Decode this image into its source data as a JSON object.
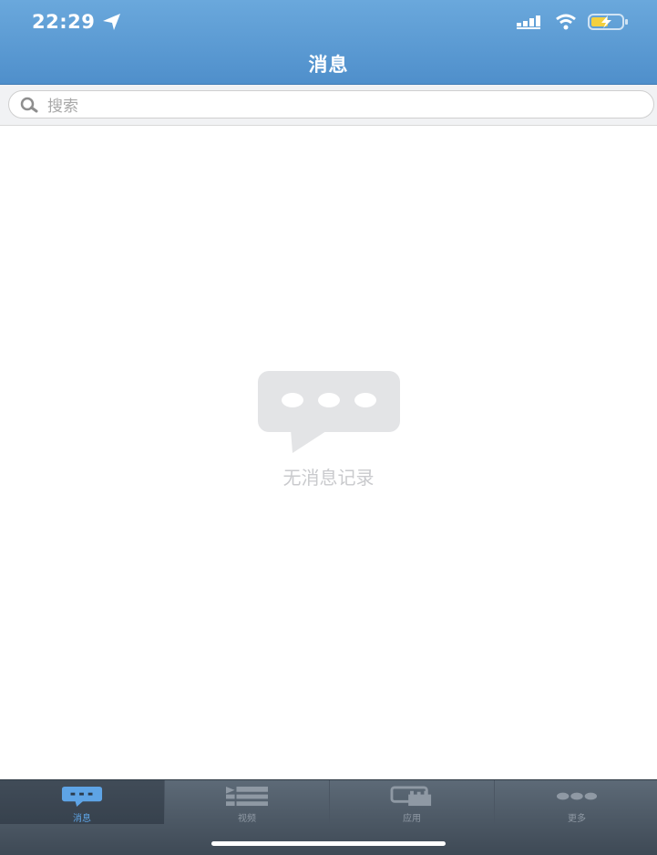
{
  "status_bar": {
    "time": "22:29"
  },
  "nav": {
    "title": "消息"
  },
  "search": {
    "placeholder": "搜索"
  },
  "empty_state": {
    "text": "无消息记录"
  },
  "tabs": [
    {
      "label": "消息",
      "icon": "chat-bubble-icon",
      "active": true
    },
    {
      "label": "视频",
      "icon": "video-list-icon",
      "active": false
    },
    {
      "label": "应用",
      "icon": "apps-icon",
      "active": false
    },
    {
      "label": "更多",
      "icon": "more-icon",
      "active": false
    }
  ],
  "colors": {
    "header": "#5a9ad3",
    "active_tab": "#5ea4e6",
    "tabbar": "#4b5663"
  }
}
